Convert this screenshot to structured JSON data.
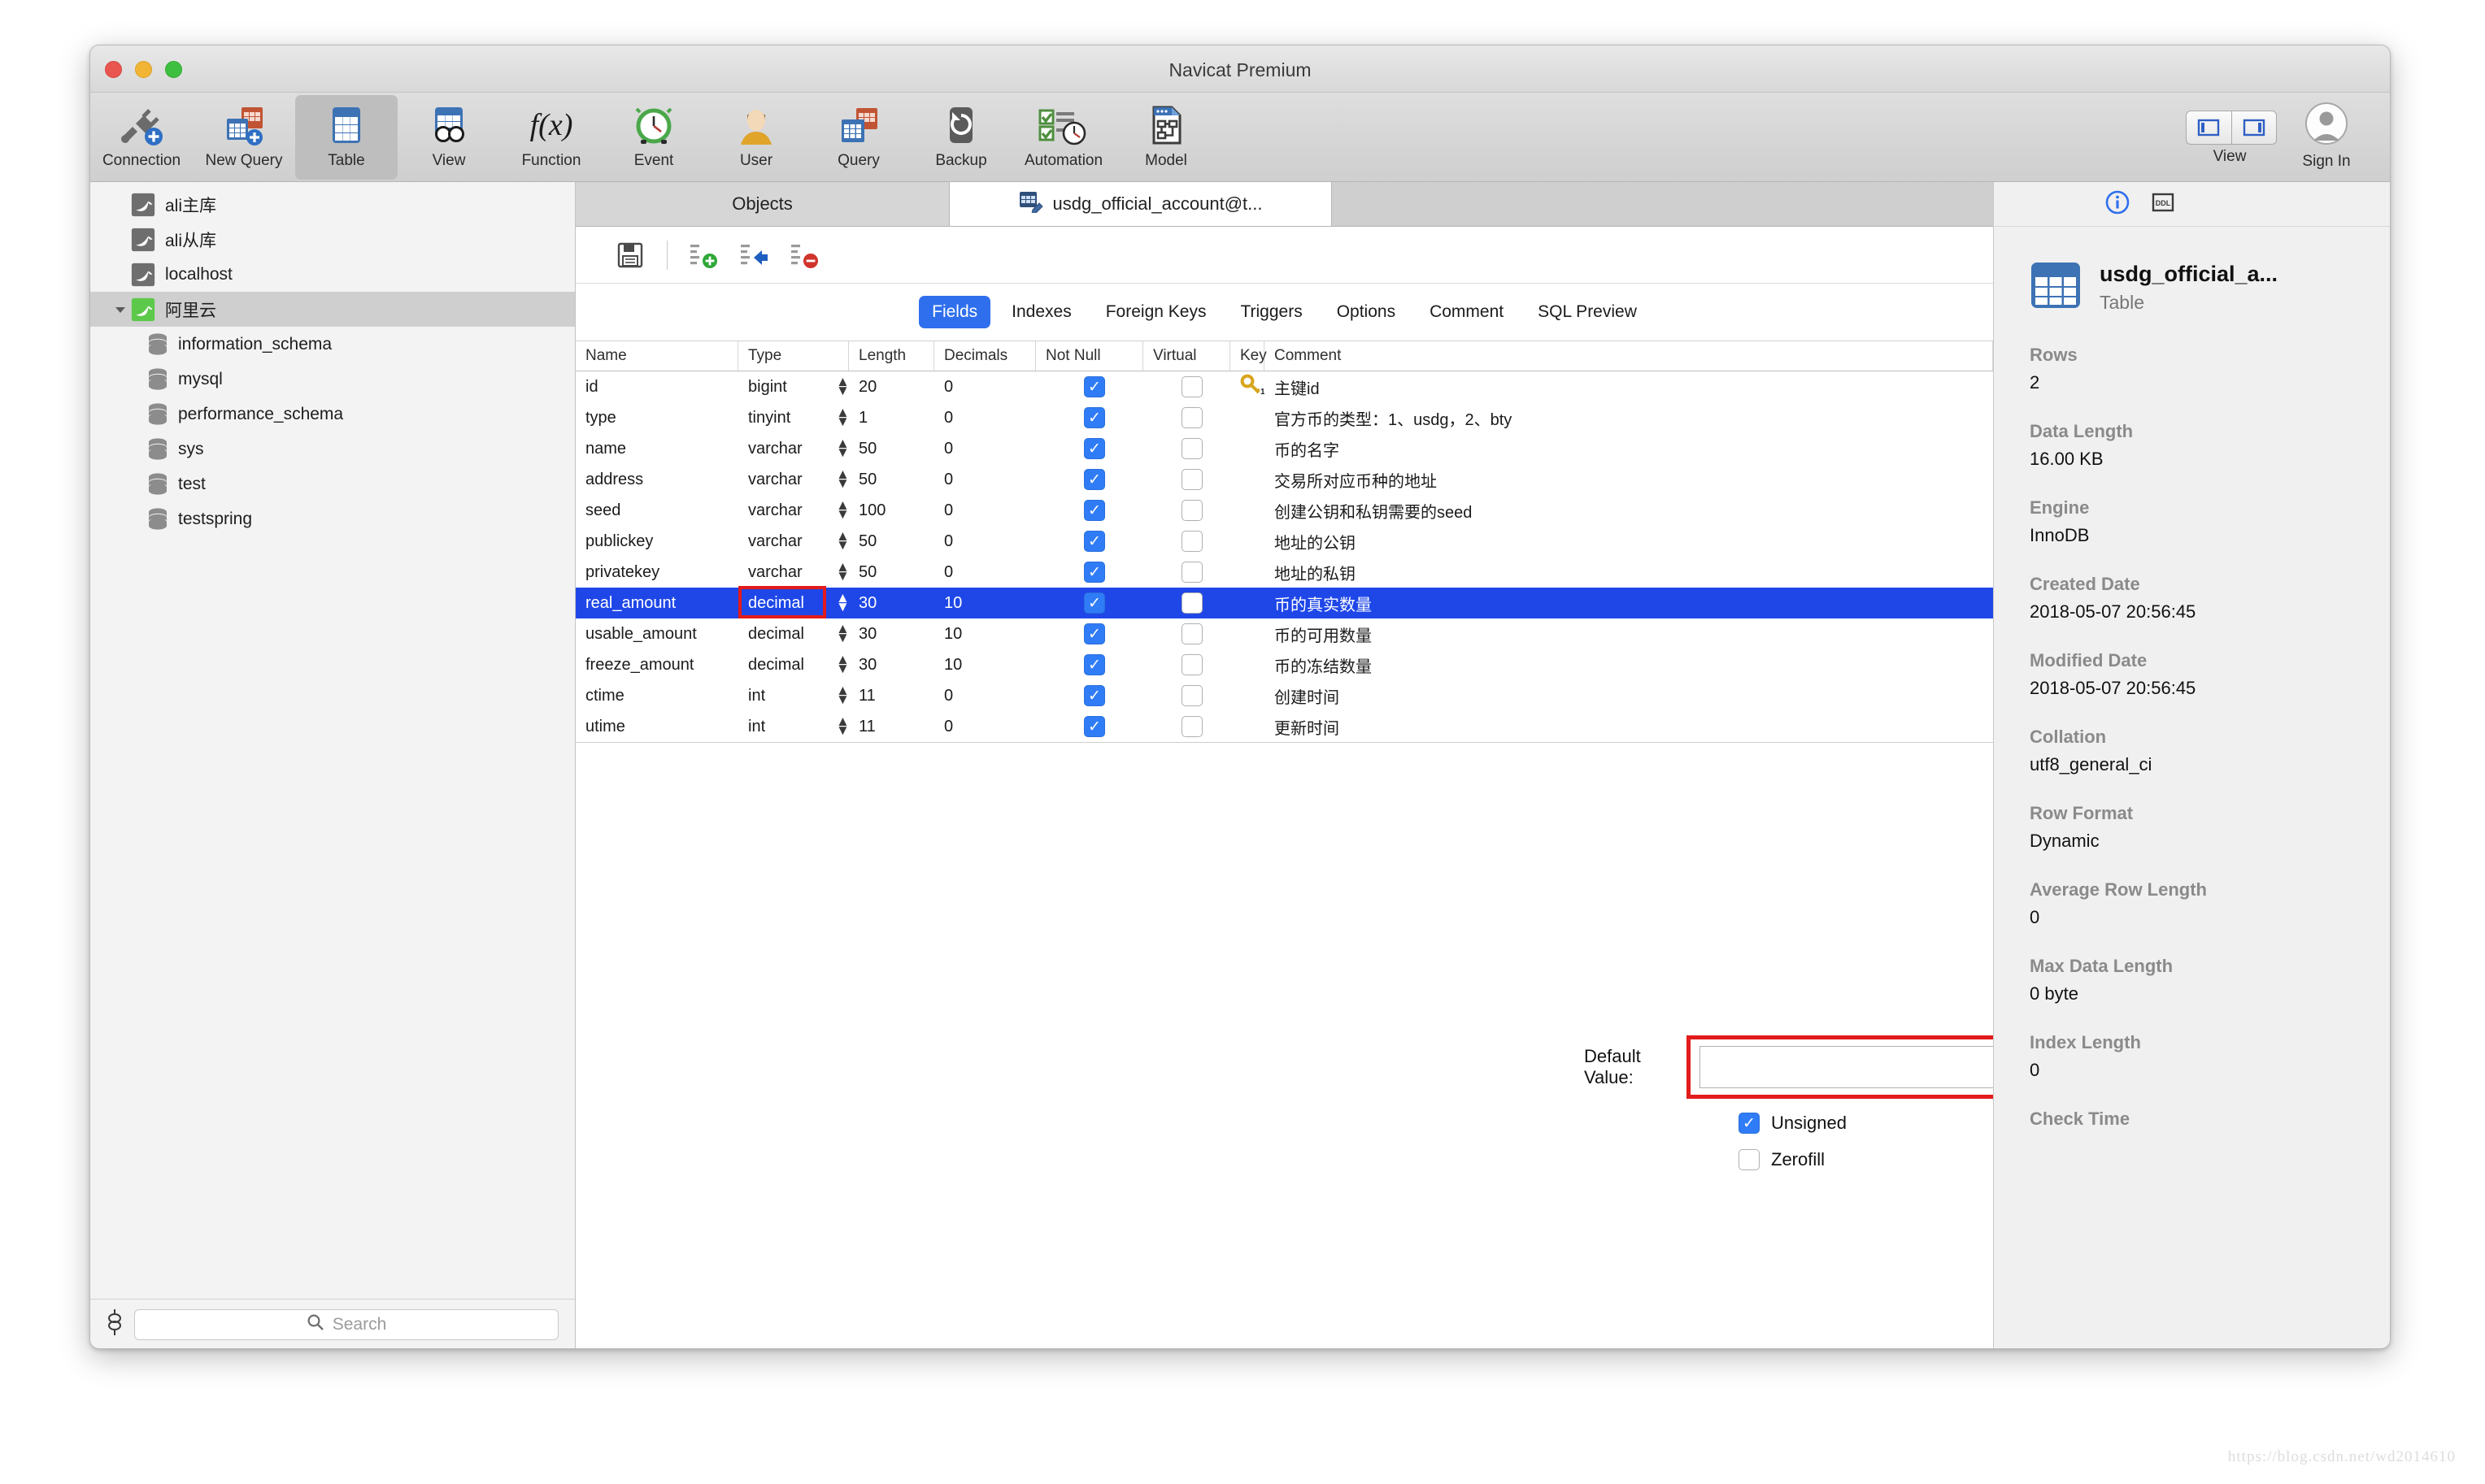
{
  "window": {
    "title": "Navicat Premium"
  },
  "toolbar": {
    "items": [
      {
        "label": "Connection",
        "icon": "connection-icon"
      },
      {
        "label": "New Query",
        "icon": "new-query-icon"
      },
      {
        "label": "Table",
        "icon": "table-icon",
        "selected": true
      },
      {
        "label": "View",
        "icon": "view-icon"
      },
      {
        "label": "Function",
        "icon": "function-icon"
      },
      {
        "label": "Event",
        "icon": "event-icon"
      },
      {
        "label": "User",
        "icon": "user-icon"
      },
      {
        "label": "Query",
        "icon": "query-icon"
      },
      {
        "label": "Backup",
        "icon": "backup-icon"
      },
      {
        "label": "Automation",
        "icon": "automation-icon"
      },
      {
        "label": "Model",
        "icon": "model-icon"
      }
    ],
    "view_label": "View",
    "signin_label": "Sign In"
  },
  "sidebar": {
    "items": [
      {
        "label": "ali主库",
        "type": "connection",
        "level": 0,
        "state": "closed"
      },
      {
        "label": "ali从库",
        "type": "connection",
        "level": 0,
        "state": "closed"
      },
      {
        "label": "localhost",
        "type": "connection",
        "level": 0,
        "state": "closed"
      },
      {
        "label": "阿里云",
        "type": "connection",
        "level": 0,
        "state": "open",
        "selected": true
      },
      {
        "label": "information_schema",
        "type": "database",
        "level": 1
      },
      {
        "label": "mysql",
        "type": "database",
        "level": 1
      },
      {
        "label": "performance_schema",
        "type": "database",
        "level": 1
      },
      {
        "label": "sys",
        "type": "database",
        "level": 1
      },
      {
        "label": "test",
        "type": "database",
        "level": 1
      },
      {
        "label": "testspring",
        "type": "database",
        "level": 1
      }
    ],
    "search": {
      "placeholder": "Search",
      "value": ""
    }
  },
  "tabs": {
    "objects_label": "Objects",
    "active_label": "usdg_official_account@t..."
  },
  "field_toolbar": [
    {
      "name": "save-button",
      "title": "Save"
    },
    {
      "name": "add-field-button",
      "title": "Add Field"
    },
    {
      "name": "insert-field-button",
      "title": "Insert Field"
    },
    {
      "name": "delete-field-button",
      "title": "Delete Field"
    }
  ],
  "subtabs": [
    {
      "label": "Fields",
      "active": true
    },
    {
      "label": "Indexes",
      "active": false
    },
    {
      "label": "Foreign Keys",
      "active": false
    },
    {
      "label": "Triggers",
      "active": false
    },
    {
      "label": "Options",
      "active": false
    },
    {
      "label": "Comment",
      "active": false
    },
    {
      "label": "SQL Preview",
      "active": false
    }
  ],
  "grid": {
    "columns": [
      "Name",
      "Type",
      "Length",
      "Decimals",
      "Not Null",
      "Virtual",
      "Key",
      "Comment"
    ],
    "rows": [
      {
        "name": "id",
        "type": "bigint",
        "length": "20",
        "decimals": "0",
        "not_null": true,
        "virtual": false,
        "key": "primary",
        "comment": "主键id",
        "selected": false
      },
      {
        "name": "type",
        "type": "tinyint",
        "length": "1",
        "decimals": "0",
        "not_null": true,
        "virtual": false,
        "key": "",
        "comment": "官方币的类型：1、usdg，2、bty",
        "selected": false
      },
      {
        "name": "name",
        "type": "varchar",
        "length": "50",
        "decimals": "0",
        "not_null": true,
        "virtual": false,
        "key": "",
        "comment": "币的名字",
        "selected": false
      },
      {
        "name": "address",
        "type": "varchar",
        "length": "50",
        "decimals": "0",
        "not_null": true,
        "virtual": false,
        "key": "",
        "comment": "交易所对应币种的地址",
        "selected": false
      },
      {
        "name": "seed",
        "type": "varchar",
        "length": "100",
        "decimals": "0",
        "not_null": true,
        "virtual": false,
        "key": "",
        "comment": "创建公钥和私钥需要的seed",
        "selected": false
      },
      {
        "name": "publickey",
        "type": "varchar",
        "length": "50",
        "decimals": "0",
        "not_null": true,
        "virtual": false,
        "key": "",
        "comment": "地址的公钥",
        "selected": false
      },
      {
        "name": "privatekey",
        "type": "varchar",
        "length": "50",
        "decimals": "0",
        "not_null": true,
        "virtual": false,
        "key": "",
        "comment": "地址的私钥",
        "selected": false
      },
      {
        "name": "real_amount",
        "type": "decimal",
        "length": "30",
        "decimals": "10",
        "not_null": true,
        "virtual": false,
        "key": "",
        "comment": "币的真实数量",
        "selected": true
      },
      {
        "name": "usable_amount",
        "type": "decimal",
        "length": "30",
        "decimals": "10",
        "not_null": true,
        "virtual": false,
        "key": "",
        "comment": "币的可用数量",
        "selected": false
      },
      {
        "name": "freeze_amount",
        "type": "decimal",
        "length": "30",
        "decimals": "10",
        "not_null": true,
        "virtual": false,
        "key": "",
        "comment": "币的冻结数量",
        "selected": false
      },
      {
        "name": "ctime",
        "type": "int",
        "length": "11",
        "decimals": "0",
        "not_null": true,
        "virtual": false,
        "key": "",
        "comment": "创建时间",
        "selected": false
      },
      {
        "name": "utime",
        "type": "int",
        "length": "11",
        "decimals": "0",
        "not_null": true,
        "virtual": false,
        "key": "",
        "comment": "更新时间",
        "selected": false
      }
    ]
  },
  "editor": {
    "default_value_label": "Default Value:",
    "default_value": "",
    "unsigned_label": "Unsigned",
    "unsigned_checked": true,
    "zerofill_label": "Zerofill",
    "zerofill_checked": false
  },
  "info_panel": {
    "icons": [
      "info-icon",
      "ddl-icon"
    ],
    "title": "usdg_official_a...",
    "subtitle": "Table",
    "properties": [
      {
        "key": "Rows",
        "value": "2"
      },
      {
        "key": "Data Length",
        "value": "16.00 KB"
      },
      {
        "key": "Engine",
        "value": "InnoDB"
      },
      {
        "key": "Created Date",
        "value": "2018-05-07 20:56:45"
      },
      {
        "key": "Modified Date",
        "value": "2018-05-07 20:56:45"
      },
      {
        "key": "Collation",
        "value": "utf8_general_ci"
      },
      {
        "key": "Row Format",
        "value": "Dynamic"
      },
      {
        "key": "Average Row Length",
        "value": "0"
      },
      {
        "key": "Max Data Length",
        "value": "0 byte"
      },
      {
        "key": "Index Length",
        "value": "0"
      },
      {
        "key": "Check Time",
        "value": ""
      }
    ]
  },
  "watermark": "https://blog.csdn.net/wd2014610",
  "colors": {
    "accent": "#2f6fed",
    "selection": "#1f47e8",
    "highlight": "#e21b1b"
  }
}
